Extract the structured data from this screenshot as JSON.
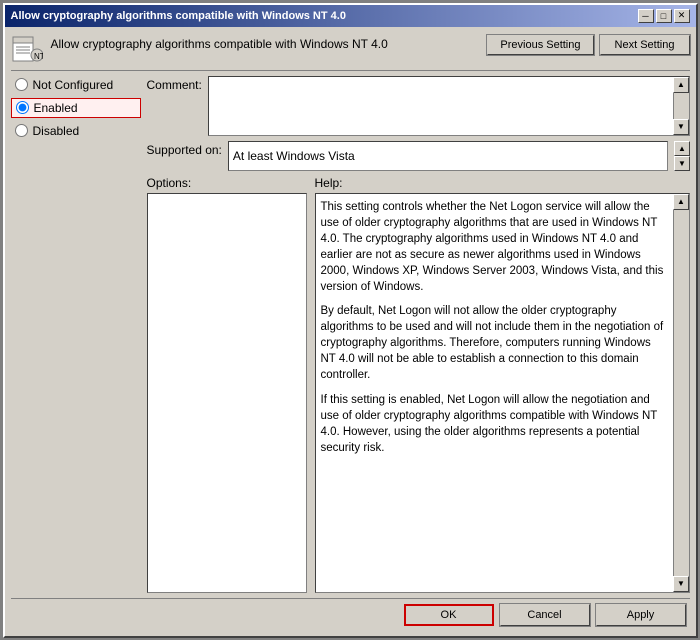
{
  "window": {
    "title": "Allow cryptography algorithms compatible with Windows NT 4.0",
    "title_buttons": {
      "minimize": "─",
      "maximize": "□",
      "close": "✕"
    }
  },
  "header": {
    "title": "Allow cryptography algorithms compatible with Windows NT 4.0",
    "previous_button": "Previous Setting",
    "next_button": "Next Setting"
  },
  "radio_options": {
    "not_configured": "Not Configured",
    "enabled": "Enabled",
    "disabled": "Disabled"
  },
  "selected_option": "enabled",
  "comment_label": "Comment:",
  "supported_label": "Supported on:",
  "supported_value": "At least Windows Vista",
  "options_label": "Options:",
  "help_label": "Help:",
  "help_text": {
    "para1": "This setting controls whether the Net Logon service will allow the use of older cryptography algorithms that are used in Windows NT 4.0. The cryptography algorithms used in Windows NT 4.0 and earlier are not as secure as newer algorithms used in Windows 2000,  Windows XP, Windows Server 2003, Windows Vista, and this version of Windows.",
    "para2": "By default, Net Logon will not allow the older cryptography algorithms to be used and will not include them in the negotiation of cryptography algorithms. Therefore, computers running Windows NT 4.0 will not be able to establish a connection to this domain controller.",
    "para3": "If this setting is enabled, Net Logon will allow the negotiation and use of older cryptography algorithms compatible with Windows NT 4.0. However, using the older algorithms represents a potential security risk."
  },
  "footer": {
    "ok": "OK",
    "cancel": "Cancel",
    "apply": "Apply"
  }
}
